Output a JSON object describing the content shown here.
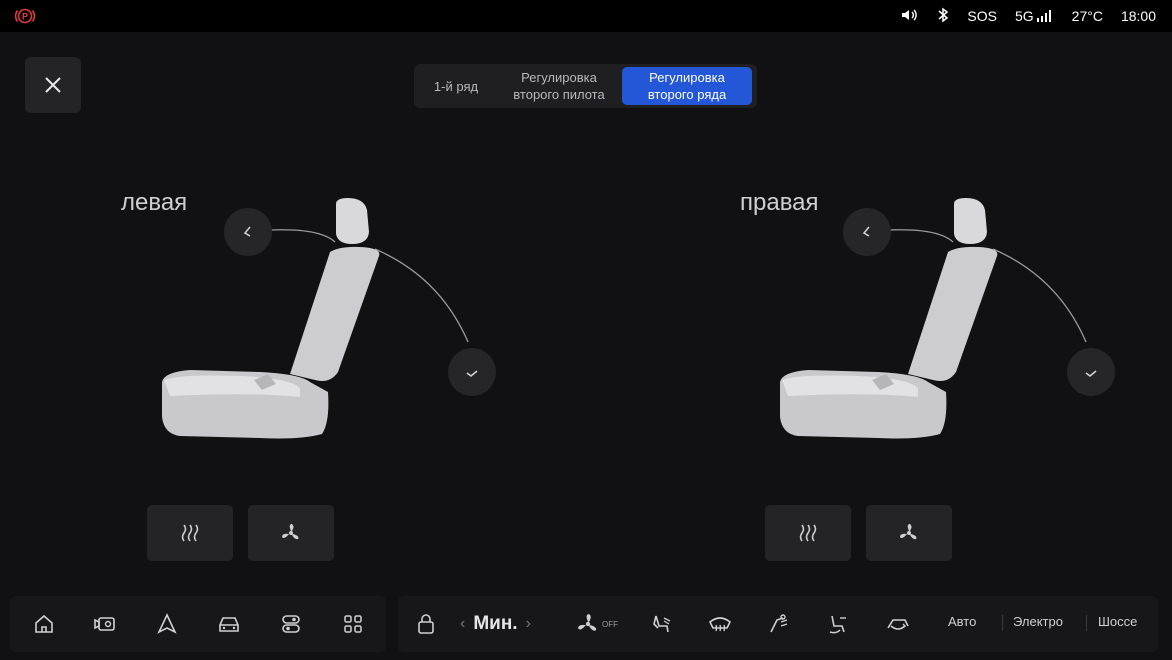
{
  "status_bar": {
    "parking_icon": "parking-brake-icon",
    "sos": "SOS",
    "network": "5G",
    "temperature": "27°C",
    "time": "18:00"
  },
  "tabs": [
    {
      "label": "1-й ряд",
      "active": false
    },
    {
      "label": "Регулировка\nвторого пилота",
      "active": false
    },
    {
      "label": "Регулировка\nвторого ряда",
      "active": true
    }
  ],
  "seats": {
    "left": {
      "label": "левая"
    },
    "right": {
      "label": "правая"
    }
  },
  "dock": {
    "fan_level": "Мин.",
    "fan_off_label": "OFF",
    "modes": [
      "Авто",
      "Электро",
      "Шоссе"
    ]
  },
  "colors": {
    "accent": "#2357d8",
    "background": "#111113",
    "panel": "#242427"
  }
}
